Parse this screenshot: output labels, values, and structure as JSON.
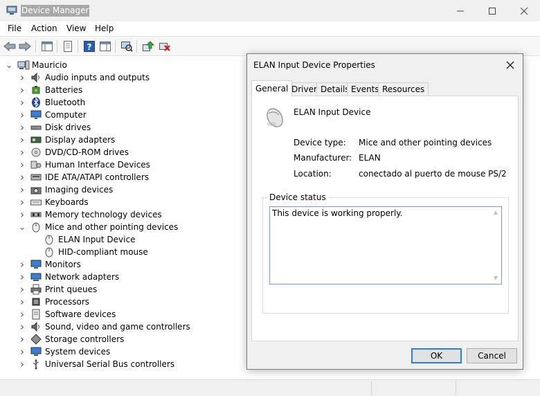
{
  "window": {
    "title": "Device Manager"
  },
  "menu": [
    "File",
    "Action",
    "View",
    "Help"
  ],
  "toolbar_icons": [
    "back-icon",
    "forward-icon",
    "show-hide-console-tree-icon",
    "properties-icon",
    "help-icon",
    "action-pane-icon",
    "scan-hardware-icon",
    "update-driver-icon",
    "uninstall-device-icon"
  ],
  "tree": {
    "root": "Mauricio",
    "categories": [
      {
        "label": "Audio inputs and outputs",
        "icon": "speaker-icon",
        "expanded": false
      },
      {
        "label": "Batteries",
        "icon": "battery-icon",
        "expanded": false
      },
      {
        "label": "Bluetooth",
        "icon": "bluetooth-icon",
        "expanded": false
      },
      {
        "label": "Computer",
        "icon": "computer-icon",
        "expanded": false
      },
      {
        "label": "Disk drives",
        "icon": "disk-drive-icon",
        "expanded": false
      },
      {
        "label": "Display adapters",
        "icon": "display-adapter-icon",
        "expanded": false
      },
      {
        "label": "DVD/CD-ROM drives",
        "icon": "dvd-drive-icon",
        "expanded": false
      },
      {
        "label": "Human Interface Devices",
        "icon": "hid-icon",
        "expanded": false
      },
      {
        "label": "IDE ATA/ATAPI controllers",
        "icon": "ide-controller-icon",
        "expanded": false
      },
      {
        "label": "Imaging devices",
        "icon": "camera-icon",
        "expanded": false
      },
      {
        "label": "Keyboards",
        "icon": "keyboard-icon",
        "expanded": false
      },
      {
        "label": "Memory technology devices",
        "icon": "memory-icon",
        "expanded": false
      },
      {
        "label": "Mice and other pointing devices",
        "icon": "mouse-icon",
        "expanded": true
      },
      {
        "label": "ELAN Input Device",
        "icon": "mouse-icon",
        "child": true
      },
      {
        "label": "HID-compliant mouse",
        "icon": "mouse-icon",
        "child": true
      },
      {
        "label": "Monitors",
        "icon": "monitor-icon",
        "expanded": false
      },
      {
        "label": "Network adapters",
        "icon": "network-adapter-icon",
        "expanded": false
      },
      {
        "label": "Print queues",
        "icon": "printer-icon",
        "expanded": false
      },
      {
        "label": "Processors",
        "icon": "processor-icon",
        "expanded": false
      },
      {
        "label": "Software devices",
        "icon": "software-device-icon",
        "expanded": false
      },
      {
        "label": "Sound, video and game controllers",
        "icon": "speaker-icon",
        "expanded": false
      },
      {
        "label": "Storage controllers",
        "icon": "storage-controller-icon",
        "expanded": false
      },
      {
        "label": "System devices",
        "icon": "system-device-icon",
        "expanded": false
      },
      {
        "label": "Universal Serial Bus controllers",
        "icon": "usb-icon",
        "expanded": false
      }
    ]
  },
  "dialog": {
    "title": "ELAN Input Device Properties",
    "tabs": [
      "General",
      "Driver",
      "Details",
      "Events",
      "Resources"
    ],
    "active_tab": "General",
    "device_name": "ELAN Input Device",
    "properties": [
      {
        "label": "Device type:",
        "value": "Mice and other pointing devices"
      },
      {
        "label": "Manufacturer:",
        "value": "ELAN"
      },
      {
        "label": "Location:",
        "value": "conectado al puerto de mouse PS/2"
      }
    ],
    "status_group_title": "Device status",
    "status_text": "This device is working properly.",
    "ok_label": "OK",
    "cancel_label": "Cancel"
  },
  "colors": {
    "accent": "#2d7fd1",
    "title_highlight": "#a9a9a9"
  }
}
